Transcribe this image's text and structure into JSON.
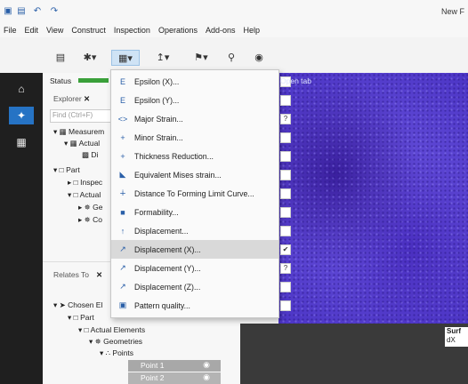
{
  "app": {
    "title_fragment": "New F"
  },
  "menubar": [
    "File",
    "Edit",
    "View",
    "Construct",
    "Inspection",
    "Operations",
    "Add-ons",
    "Help"
  ],
  "explorer": {
    "status_label": "Status",
    "tab_label": "Explorer",
    "search_placeholder": "Find (Ctrl+F)",
    "tree": [
      "Measurem",
      "Actual",
      "Di",
      "Part",
      "Inspec",
      "Actual",
      "Ge",
      "Co"
    ]
  },
  "relates": {
    "tab_label": "Relates To",
    "tree": [
      "Chosen El",
      "Part",
      "Actual Elements",
      "Geometries",
      "Points",
      "Point 1",
      "Point 2"
    ]
  },
  "viewport": {
    "tab_label": "Open tab",
    "overlay_1": "Surf",
    "overlay_2": "dX"
  },
  "dropdown": [
    {
      "icon": "E",
      "label": "Epsilon (X)...",
      "hl": false,
      "check": ""
    },
    {
      "icon": "E",
      "label": "Epsilon (Y)...",
      "hl": false,
      "check": ""
    },
    {
      "icon": "<>",
      "label": "Major Strain...",
      "hl": false,
      "check": "?"
    },
    {
      "icon": "+",
      "label": "Minor Strain...",
      "hl": false,
      "check": ""
    },
    {
      "icon": "+",
      "label": "Thickness Reduction...",
      "hl": false,
      "check": ""
    },
    {
      "icon": "◣",
      "label": "Equivalent Mises strain...",
      "hl": false,
      "check": ""
    },
    {
      "icon": "∔",
      "label": "Distance To Forming Limit Curve...",
      "hl": false,
      "check": ""
    },
    {
      "icon": "■",
      "label": "Formability...",
      "hl": false,
      "check": ""
    },
    {
      "icon": "↑",
      "label": "Displacement...",
      "hl": false,
      "check": ""
    },
    {
      "icon": "↗",
      "label": "Displacement (X)...",
      "hl": true,
      "check": "✔"
    },
    {
      "icon": "↗",
      "label": "Displacement (Y)...",
      "hl": false,
      "check": "?"
    },
    {
      "icon": "↗",
      "label": "Displacement (Z)...",
      "hl": false,
      "check": ""
    },
    {
      "icon": "▣",
      "label": "Pattern quality...",
      "hl": false,
      "check": ""
    }
  ]
}
